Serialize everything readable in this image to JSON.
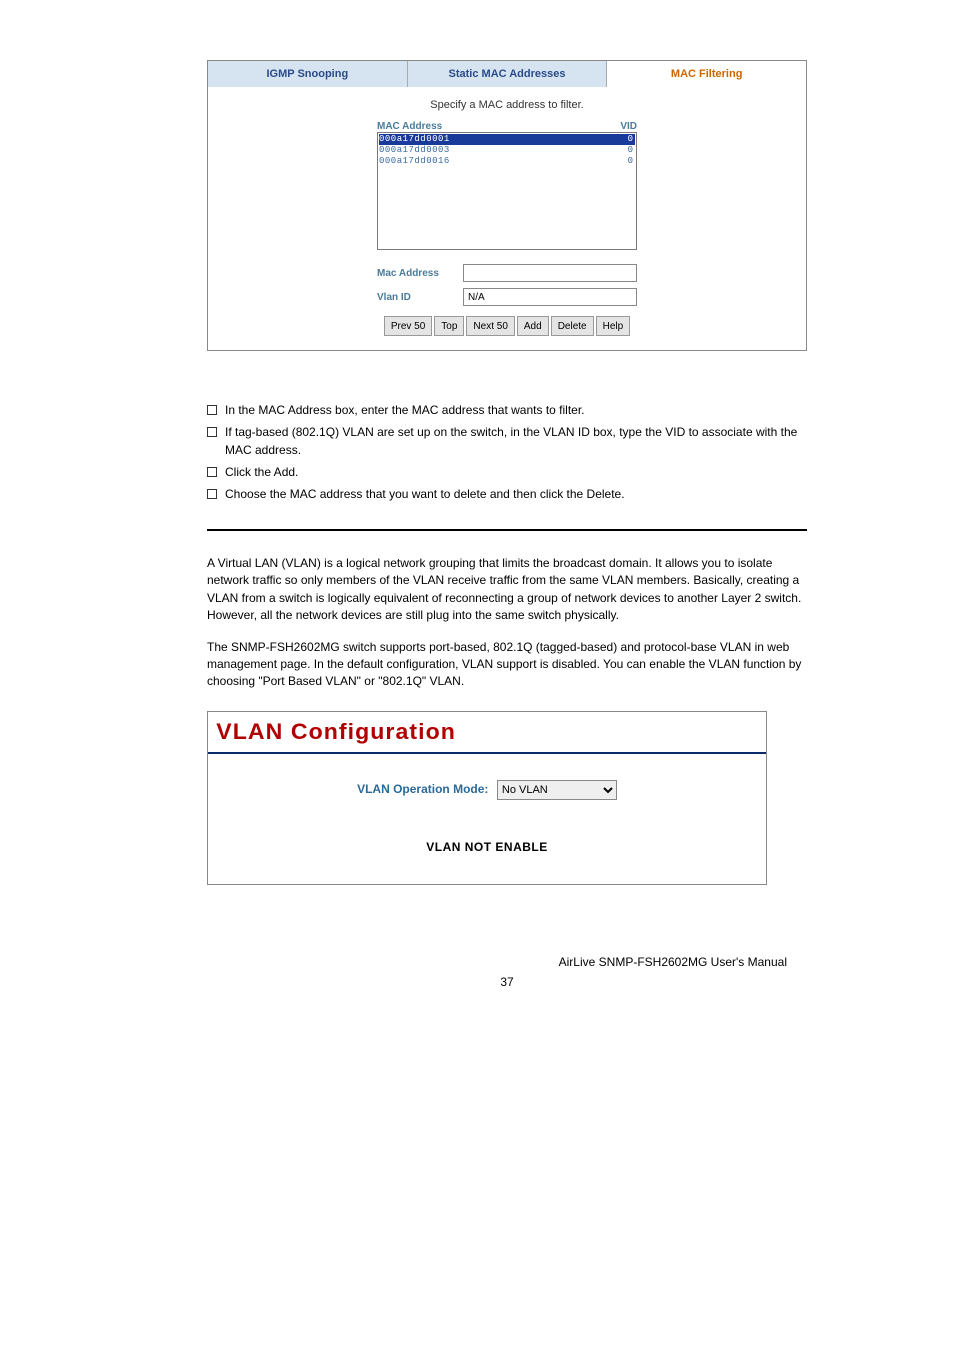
{
  "screenshot1": {
    "tabs": {
      "igmp": "IGMP Snooping",
      "static": "Static MAC Addresses",
      "filter": "MAC Filtering"
    },
    "caption": "Specify a MAC address to filter.",
    "col_mac": "MAC Address",
    "col_vid": "VID",
    "rows": [
      {
        "mac": "000a17dd0001",
        "vid": "0"
      },
      {
        "mac": "000a17dd0003",
        "vid": "0"
      },
      {
        "mac": "000a17dd0016",
        "vid": "0"
      }
    ],
    "label_mac": "Mac Address",
    "label_vlan": "Vlan ID",
    "value_mac": "",
    "value_vlan": "N/A",
    "buttons": {
      "prev": "Prev 50",
      "top": "Top",
      "next": "Next 50",
      "add": "Add",
      "delete": "Delete",
      "help": "Help"
    }
  },
  "bullets": {
    "b1": "In the MAC Address box, enter the MAC address that wants to filter.",
    "b2": "If tag-based (802.1Q) VLAN are set up on the switch, in the VLAN ID box, type the VID to associate with the MAC address.",
    "b3": "Click the Add.",
    "b4": "Choose the MAC address that you want to delete and then click the Delete."
  },
  "para1": "A Virtual LAN (VLAN) is a logical network grouping that limits the broadcast domain. It allows you to isolate network traffic so only members of the VLAN receive traffic from the same VLAN members. Basically, creating a VLAN from a switch is logically equivalent of reconnecting a group of network devices to another Layer 2 switch. However, all the network devices are still plug into the same switch physically.",
  "para2": "The SNMP-FSH2602MG switch supports port-based, 802.1Q (tagged-based) and protocol-base VLAN in web management page. In the default configuration, VLAN support is disabled.   You can enable the VLAN function by choosing \"Port Based VLAN\" or \"802.1Q\" VLAN.",
  "screenshot2": {
    "title": "VLAN Configuration",
    "mode_label": "VLAN Operation Mode:",
    "mode_value": "No VLAN",
    "not_enable": "VLAN NOT ENABLE"
  },
  "footer": "AirLive SNMP-FSH2602MG User's Manual",
  "pagenum": "37"
}
